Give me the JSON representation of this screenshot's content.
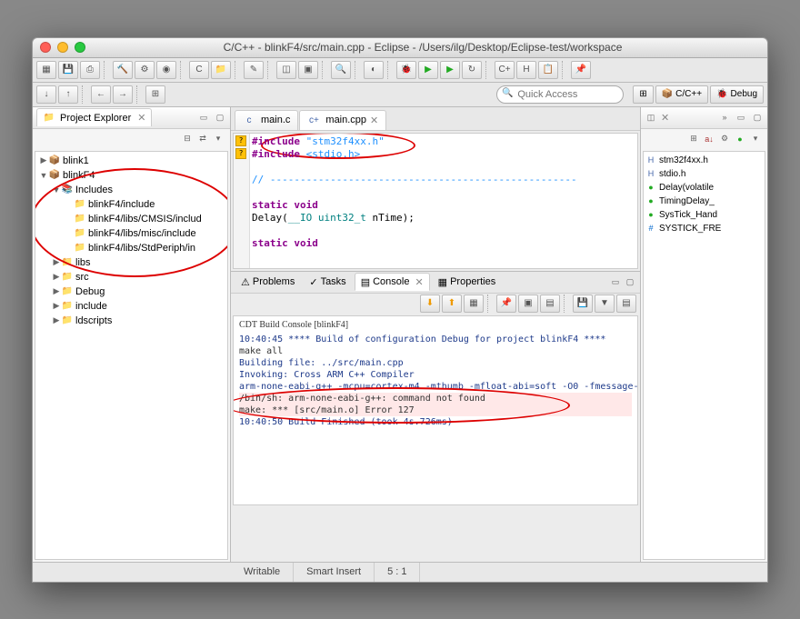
{
  "title": "C/C++ - blinkF4/src/main.cpp - Eclipse - /Users/ilg/Desktop/Eclipse-test/workspace",
  "quick_access_placeholder": "Quick Access",
  "perspectives": {
    "cpp": "C/C++",
    "debug": "Debug"
  },
  "project_explorer": {
    "title": "Project Explorer",
    "items": {
      "blink1": "blink1",
      "blinkF4": "blinkF4",
      "includes": "Includes",
      "inc0": "blinkF4/include",
      "inc1": "blinkF4/libs/CMSIS/includ",
      "inc2": "blinkF4/libs/misc/include",
      "inc3": "blinkF4/libs/StdPeriph/in",
      "libs": "libs",
      "src": "src",
      "debug": "Debug",
      "include": "include",
      "ldscripts": "ldscripts"
    }
  },
  "editor": {
    "tabs": {
      "mainc": "main.c",
      "maincpp": "main.cpp"
    },
    "lines": {
      "l0a": "#include",
      "l0b": " \"stm32f4xx.h\"",
      "l1a": "#include",
      "l1b": " <stdio.h>",
      "l2": "",
      "l3": "// ---------------------------------------------------",
      "l4": "",
      "l5a": "static void",
      "l6a": "Delay(",
      "l6b": "__IO",
      "l6c": " uint32_t",
      "l6d": " nTime);",
      "l7": "",
      "l8a": "static void"
    }
  },
  "bottom_tabs": {
    "problems": "Problems",
    "tasks": "Tasks",
    "console": "Console",
    "properties": "Properties"
  },
  "console": {
    "header": "CDT Build Console [blinkF4]",
    "lines": {
      "c0": "10:40:45 **** Build of configuration Debug for project blinkF4 ****",
      "c1": "make all ",
      "c2": "Building file: ../src/main.cpp",
      "c3": "Invoking: Cross ARM C++ Compiler",
      "c4": "arm-none-eabi-g++ -mcpu=cortex-m4 -mthumb -mfloat-abi=soft -O0 -fmessage-",
      "c5": "/bin/sh: arm-none-eabi-g++: command not found",
      "c6": "make: *** [src/main.o] Error 127",
      "c7": "",
      "c8": "10:40:50 Build Finished (took 4s.726ms)"
    }
  },
  "outline": {
    "items": {
      "o0": "stm32f4xx.h",
      "o1": "stdio.h",
      "o2": "Delay(volatile",
      "o3": "TimingDelay_",
      "o4": "SysTick_Hand",
      "o5": "SYSTICK_FRE"
    }
  },
  "status": {
    "writable": "Writable",
    "insert": "Smart Insert",
    "pos": "5 : 1"
  }
}
